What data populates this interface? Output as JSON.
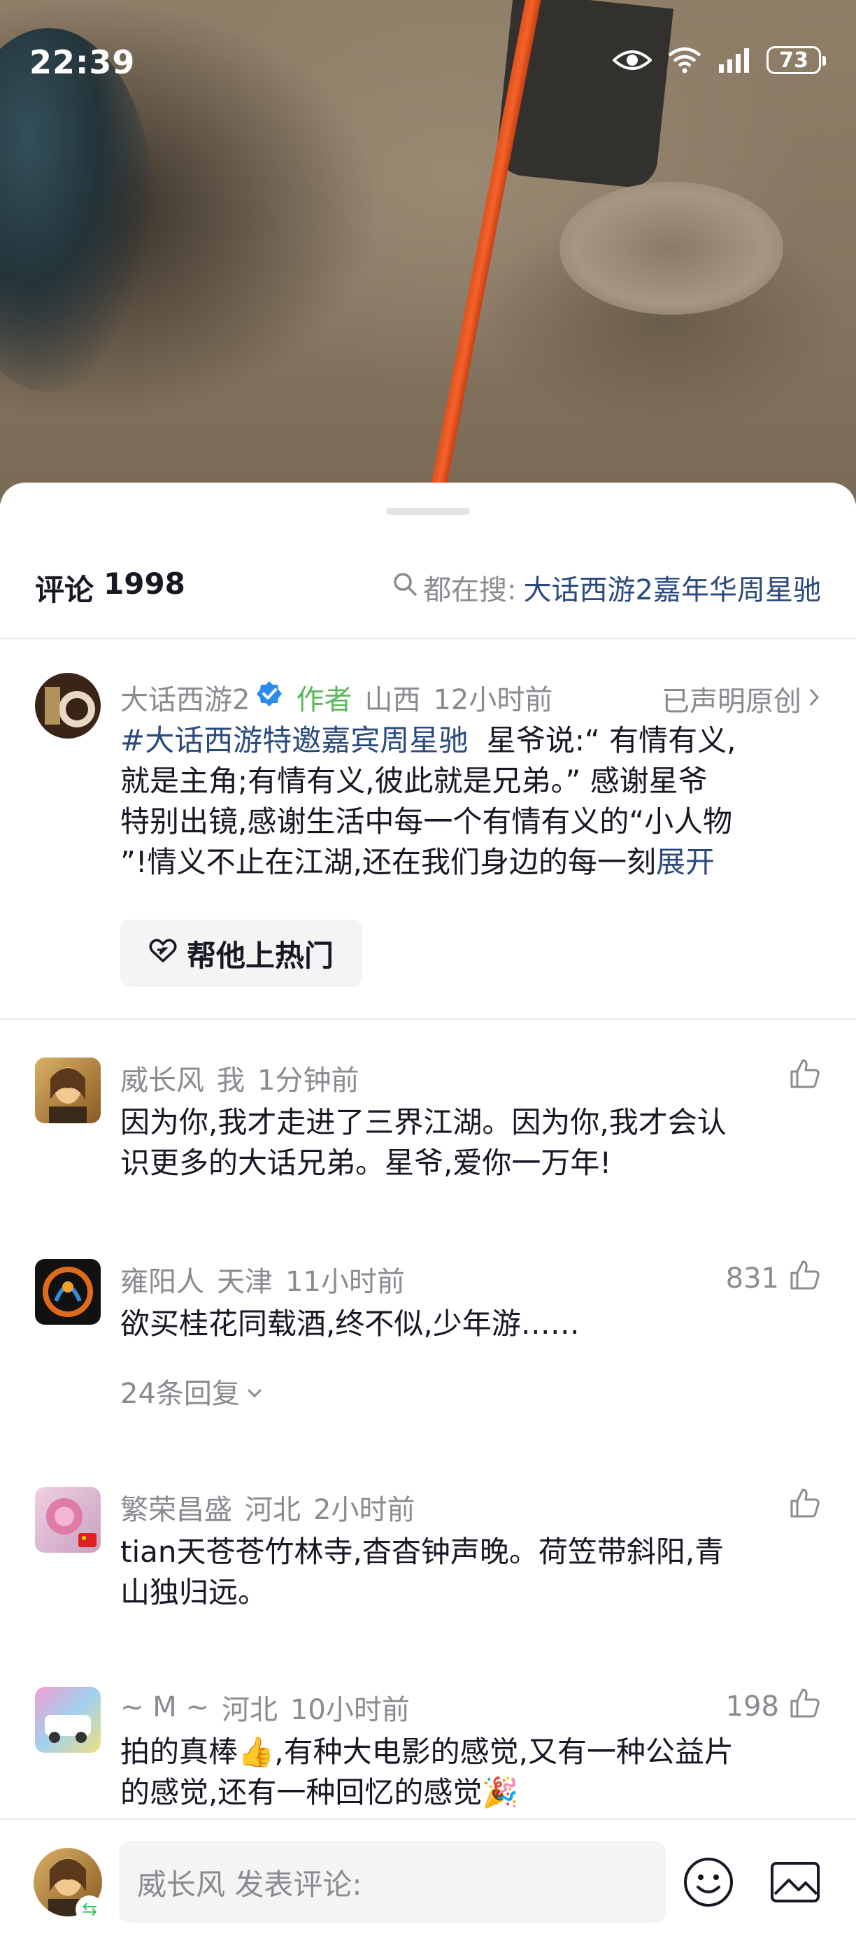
{
  "status_bar": {
    "time": "22:39",
    "battery": "73"
  },
  "header": {
    "comments_label": "评论",
    "comments_count": "1998",
    "search_prefix": "都在搜:",
    "search_term": "大话西游2嘉年华周星驰"
  },
  "author_post": {
    "name": "大话西游2",
    "author_tag": "作者",
    "location": "山西",
    "time": "12小时前",
    "declared": "已声明原创",
    "hashtag": "#大话西游特邀嘉宾周星驰",
    "text_line1": "星爷说:“ 有情有义,",
    "text_line2": "就是主角;有情有义,彼此就是兄弟。” 感谢星爷",
    "text_line3": "特别出镜,感谢生活中每一个有情有义的“小人物",
    "text_line4": "”!情义不止在江湖,还在我们身边的每一刻",
    "expand": "展开",
    "boost_label": "帮他上热门"
  },
  "comments": [
    {
      "name": "威长风",
      "tag": "我",
      "location": "",
      "time": "1分钟前",
      "likes": "",
      "line1": "因为你,我才走进了三界江湖。因为你,我才会认",
      "line2": "识更多的大话兄弟。星爷,爱你一万年!"
    },
    {
      "name": "雍阳人",
      "tag": "",
      "location": "天津",
      "time": "11小时前",
      "likes": "831",
      "line1": "欲买桂花同载酒,终不似,少年游……",
      "line2": "",
      "replies": "24条回复"
    },
    {
      "name": "繁荣昌盛",
      "tag": "",
      "location": "河北",
      "time": "2小时前",
      "likes": "",
      "line1": "tian天苍苍竹林寺,杳杳钟声晚。荷笠带斜阳,青",
      "line2": "山独归远。"
    },
    {
      "name": "~ M ~",
      "tag": "",
      "location": "河北",
      "time": "10小时前",
      "likes": "198",
      "line1": "拍的真棒👍,有种大电影的感觉,又有一种公益片",
      "line2": "的感觉,还有一种回忆的感觉🎉"
    }
  ],
  "input_bar": {
    "placeholder": "威长风 发表评论:"
  },
  "colors": {
    "link": "#2a4a7f",
    "muted": "#8a8b91",
    "author_tag": "#5cb85c",
    "verified": "#2b8cf0"
  }
}
